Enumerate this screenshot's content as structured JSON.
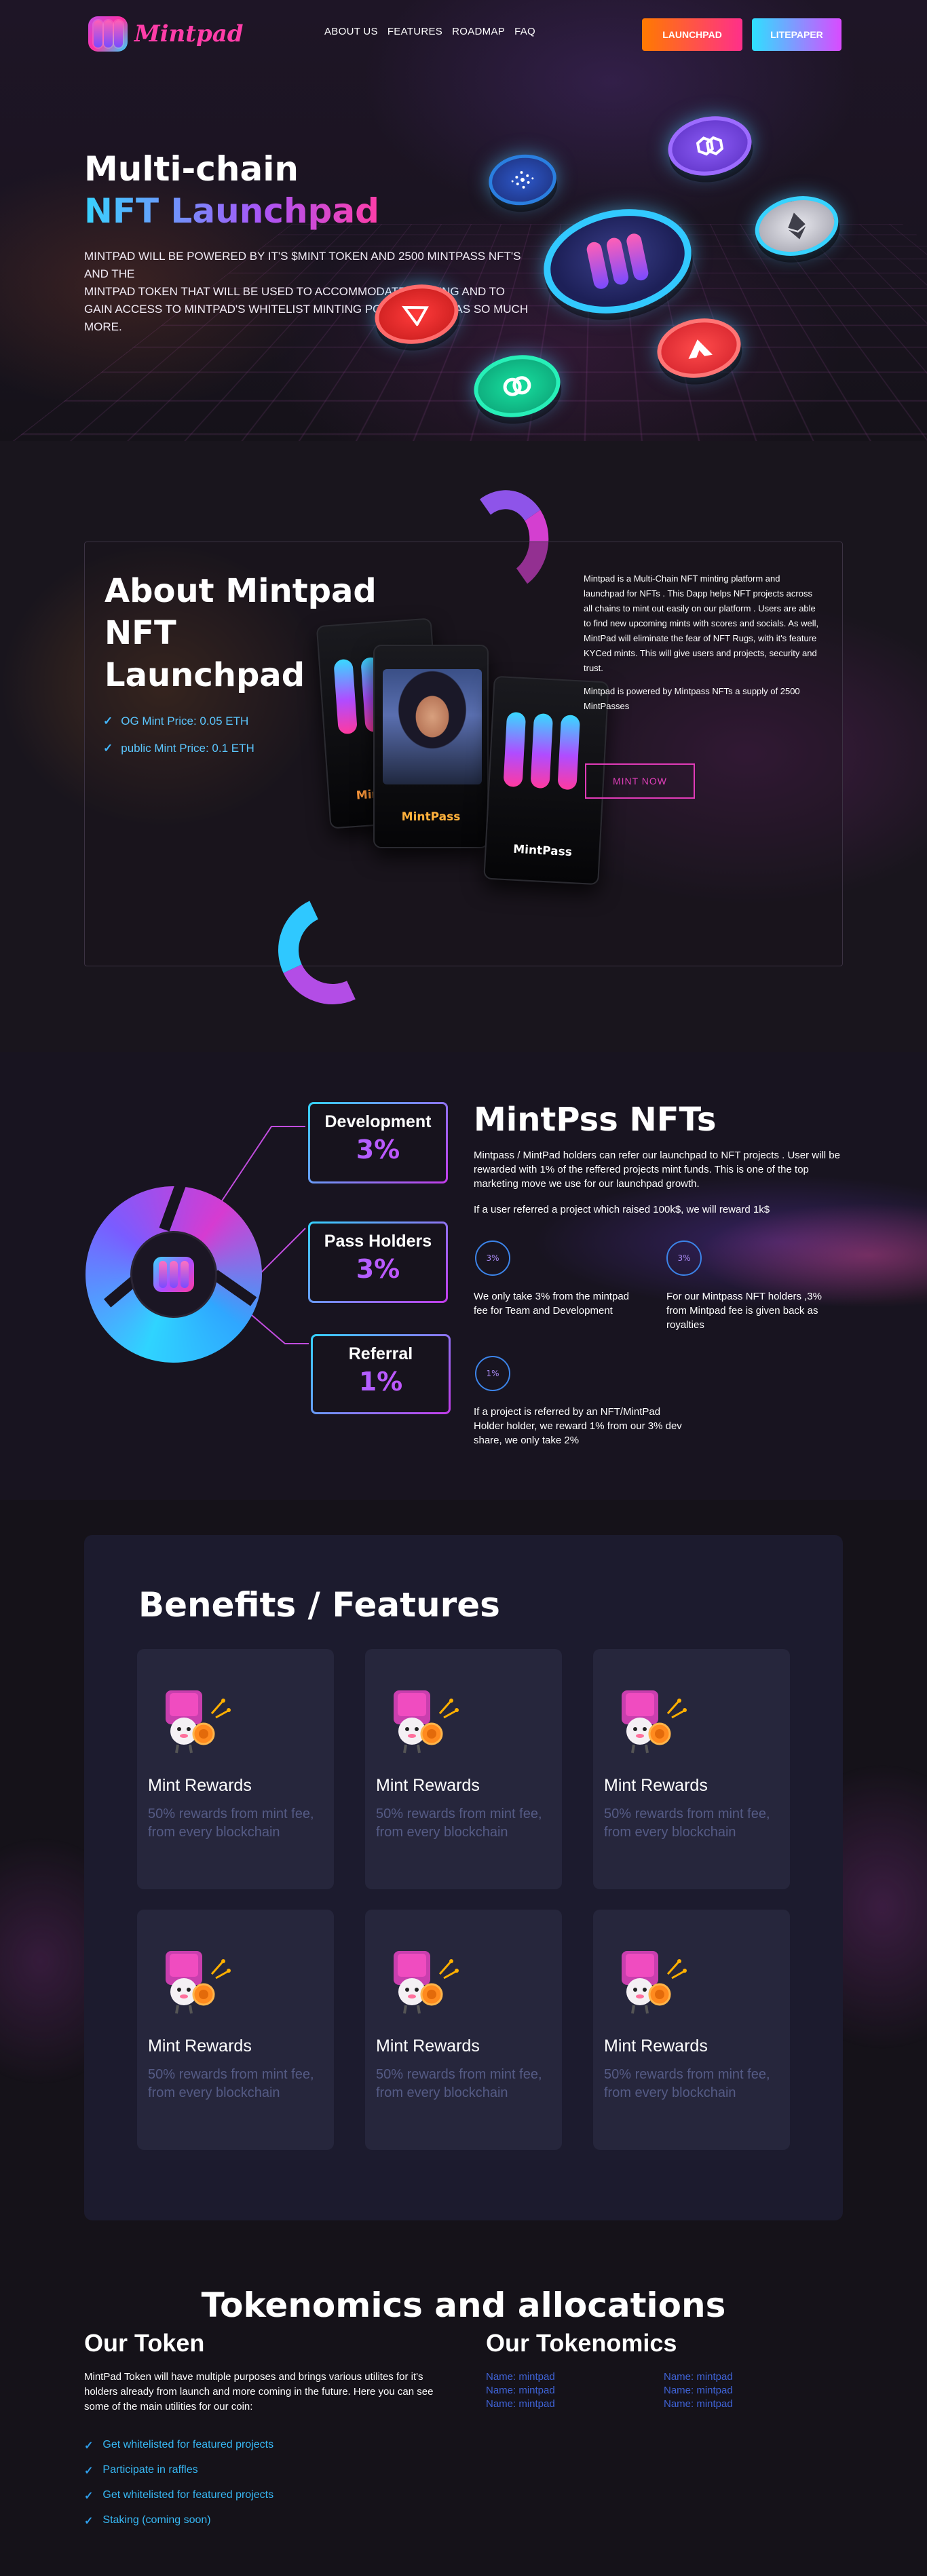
{
  "header": {
    "brand": "Mintpad",
    "nav": [
      "ABOUT US",
      "FEATURES",
      "ROADMAP",
      "FAQ"
    ],
    "launchpad_button": "LAUNCHPAD",
    "litepaper_button": "LITEPAPER"
  },
  "hero": {
    "title_line1": "Multi-chain",
    "title_line2": "NFT Launchpad",
    "description": "MINTPAD WILL BE POWERED BY IT'S $MINT TOKEN AND 2500 MINTPASS NFT'S AND THE\nMINTPAD TOKEN THAT WILL BE USED TO ACCOMMODATE STAKING AND TO GAIN ACCESS TO MINTPAD'S WHITELIST MINTING POOL, AS WELL AS SO MUCH MORE."
  },
  "about": {
    "title": "About Mintpad\nNFT\nLaunchpad",
    "prices": [
      "OG Mint Price: 0.05 ETH",
      "public Mint Price: 0.1 ETH"
    ],
    "cards": [
      "Mintpass",
      "MintPass",
      "MintPass"
    ],
    "paragraph1": "Mintpad is a Multi-Chain NFT minting platform and launchpad for NFTs . This Dapp helps NFT projects across all chains to mint out easily on our platform . Users are able to find new upcoming mints with scores and socials. As well, MintPad will eliminate the fear of NFT Rugs, with it's feature KYCed mints. This will give users and projects, security and trust.",
    "paragraph2": "Mintpad is powered by Mintpass NFTs a supply of 2500 MintPasses",
    "cta": "MINT NOW"
  },
  "mintpass": {
    "boxes": [
      {
        "title": "Development",
        "value": "3%"
      },
      {
        "title": "Pass Holders",
        "value": "3%"
      },
      {
        "title": "Referral",
        "value": "1%"
      }
    ],
    "title": "MintPss NFTs",
    "intro": "Mintpass / MintPad holders can refer our launchpad to NFT projects . User will be rewarded with 1% of the reffered projects mint funds. This is one of the top marketing move we use for our launchpad growth.",
    "example": "If a user referred a project which raised 100k$, we will reward 1k$",
    "points": [
      {
        "pct": "3%",
        "text": "We only take 3% from the mintpad fee for Team and Development"
      },
      {
        "pct": "3%",
        "text": "For our Mintpass NFT holders ,3% from Mintpad fee is given back as royalties"
      },
      {
        "pct": "1%",
        "text": "If a project is referred by an NFT/MintPad Holder holder, we reward 1% from our 3% dev share, we only take 2%"
      }
    ]
  },
  "benefits": {
    "title": "Benefits / Features",
    "cards": [
      {
        "name": "Mint Rewards",
        "desc": "50% rewards from mint fee, from every blockchain"
      },
      {
        "name": "Mint Rewards",
        "desc": "50% rewards from mint fee, from every blockchain"
      },
      {
        "name": "Mint Rewards",
        "desc": "50% rewards from mint fee, from every blockchain"
      },
      {
        "name": "Mint Rewards",
        "desc": "50% rewards from mint fee, from every blockchain"
      },
      {
        "name": "Mint Rewards",
        "desc": "50% rewards from mint fee, from every blockchain"
      },
      {
        "name": "Mint Rewards",
        "desc": "50% rewards from mint fee, from every blockchain"
      }
    ]
  },
  "tokenomics": {
    "title": "Tokenomics and allocations",
    "our_token": "Our Token",
    "our_tokenomics": "Our Tokenomics",
    "description": "MintPad Token will have multiple purposes and brings various utilites for it's holders already from launch and more coming in the future. Here you can see some of the main utilities for our coin:",
    "utilities": [
      "Get whitelisted for featured projects",
      "Participate in raffles",
      "Get whitelisted for featured projects",
      "Staking (coming soon)"
    ],
    "allocations": [
      "Name: mintpad",
      "Name: mintpad",
      "Name: mintpad",
      "Name: mintpad",
      "Name: mintpad",
      "Name: mintpad"
    ]
  },
  "colors": {
    "background": "#151219",
    "accent_pink": "#ff3da8",
    "accent_cyan": "#37d3ff",
    "accent_purple": "#a855f7",
    "panel": "#1c1b2e",
    "card": "#26263c"
  },
  "icons": [
    "check-icon",
    "coin-icon",
    "mintpad-logo-icon",
    "reward-character-icon"
  ]
}
